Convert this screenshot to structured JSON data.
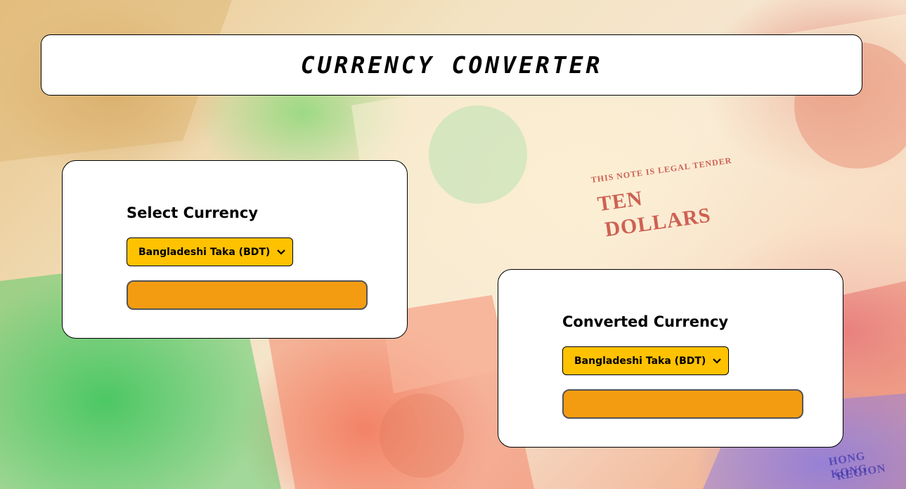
{
  "header": {
    "title": "CURRENCY CONVERTER"
  },
  "from_card": {
    "title": "Select Currency",
    "selected_currency": "Bangladeshi Taka (BDT)",
    "amount_value": ""
  },
  "to_card": {
    "title": "Converted Currency",
    "selected_currency": "Bangladeshi Taka (BDT)",
    "amount_value": ""
  },
  "background": {
    "description_icon": "banknotes-background",
    "note_text_1": "TEN",
    "note_text_2": "DOLLARS",
    "note_text_3": "THIS NOTE IS LEGAL TENDER",
    "note_text_4": "HONG KONG",
    "note_text_5": "REGION"
  },
  "colors": {
    "select_bg": "#ffc200",
    "amount_bg": "#f39c12",
    "card_bg": "#ffffff"
  }
}
